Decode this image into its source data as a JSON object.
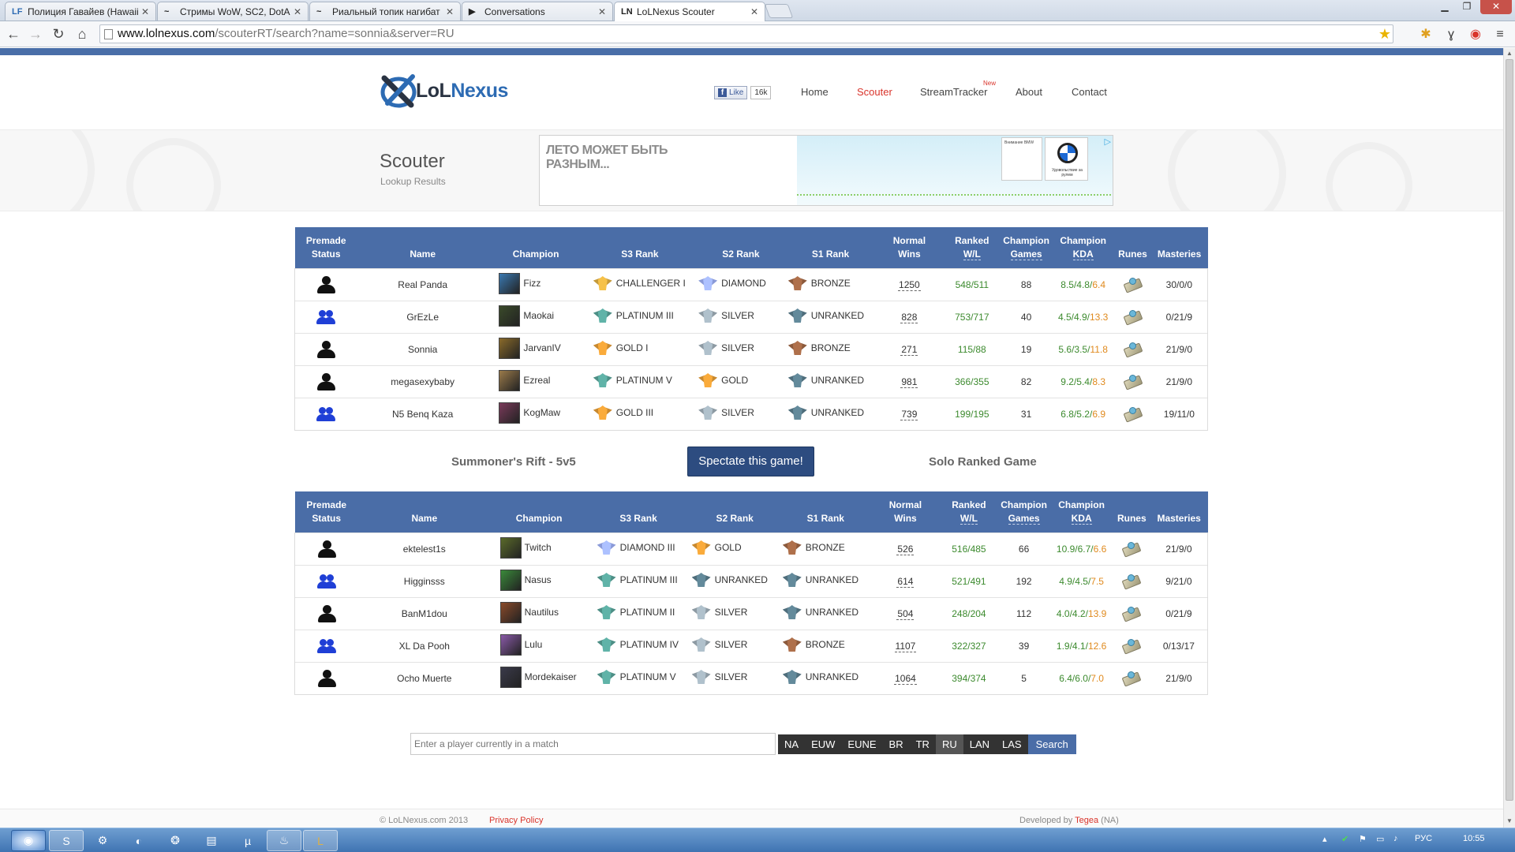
{
  "browser": {
    "tabs": [
      {
        "icon": "LF",
        "title": "Полиция Гавайев (Hawaii"
      },
      {
        "icon": "~",
        "title": "Стримы WoW, SC2, DotA"
      },
      {
        "icon": "~",
        "title": "Риальный топик нагибат"
      },
      {
        "icon": "▶",
        "title": "Conversations"
      },
      {
        "icon": "LN",
        "title": "LoLNexus Scouter"
      }
    ],
    "url_host": "www.lolnexus.com",
    "url_path": "/scouterRT/search?name=sonnia&server=RU"
  },
  "site": {
    "logo_lol": "LoL",
    "logo_nexus": "Nexus",
    "fb_like": "Like",
    "fb_count": "16k",
    "nav": [
      {
        "label": "Home",
        "active": false
      },
      {
        "label": "Scouter",
        "active": true
      },
      {
        "label": "StreamTracker",
        "active": false
      },
      {
        "label": "About",
        "active": false
      },
      {
        "label": "Contact",
        "active": false
      }
    ],
    "nav_new_badge": "New",
    "page_title": "Scouter",
    "page_subtitle": "Lookup Results",
    "ad_text": "ЛЕТО МОЖЕТ БЫТЬ РАЗНЫМ...",
    "ad_bmw_text": "Удовольствие за рулем",
    "ad_small_text": "Внимание BMW"
  },
  "table_headers": {
    "premade": [
      "Premade",
      "Status"
    ],
    "name": "Name",
    "champion": "Champion",
    "s3": "S3 Rank",
    "s2": "S2 Rank",
    "s1": "S1 Rank",
    "normal": [
      "Normal",
      "Wins"
    ],
    "ranked": [
      "Ranked",
      "W/L"
    ],
    "games": [
      "Champion",
      "Games"
    ],
    "kda": [
      "Champion",
      "KDA"
    ],
    "runes": "Runes",
    "masteries": "Masteries"
  },
  "team1": [
    {
      "premade": "solo",
      "name": "Real Panda",
      "champion": "Fizz",
      "champ_color": "#3a78b0",
      "s3": "CHALLENGER I",
      "s3_tier": "challenger",
      "s2": "DIAMOND",
      "s2_tier": "diamond",
      "s1": "BRONZE",
      "s1_tier": "bronze",
      "normal_wins": "1250",
      "ranked_wl": "548/511",
      "games": "88",
      "kda": "8.5/4.8/",
      "kda_ratio": "6.4",
      "masteries": "30/0/0"
    },
    {
      "premade": "group",
      "name": "GrEzLe",
      "champion": "Maokai",
      "champ_color": "#3a4a2a",
      "s3": "PLATINUM III",
      "s3_tier": "platinum",
      "s2": "SILVER",
      "s2_tier": "silver",
      "s1": "UNRANKED",
      "s1_tier": "unranked",
      "normal_wins": "828",
      "ranked_wl": "753/717",
      "games": "40",
      "kda": "4.5/4.9/",
      "kda_ratio": "13.3",
      "masteries": "0/21/9"
    },
    {
      "premade": "solo",
      "name": "Sonnia",
      "champion": "JarvanIV",
      "champ_color": "#8a6a2a",
      "s3": "GOLD I",
      "s3_tier": "gold",
      "s2": "SILVER",
      "s2_tier": "silver",
      "s1": "BRONZE",
      "s1_tier": "bronze",
      "normal_wins": "271",
      "ranked_wl": "115/88",
      "games": "19",
      "kda": "5.6/3.5/",
      "kda_ratio": "11.8",
      "masteries": "21/9/0"
    },
    {
      "premade": "solo",
      "name": "megasexybaby",
      "champion": "Ezreal",
      "champ_color": "#9a7a4a",
      "s3": "PLATINUM V",
      "s3_tier": "platinum",
      "s2": "GOLD",
      "s2_tier": "gold",
      "s1": "UNRANKED",
      "s1_tier": "unranked",
      "normal_wins": "981",
      "ranked_wl": "366/355",
      "games": "82",
      "kda": "9.2/5.4/",
      "kda_ratio": "8.3",
      "masteries": "21/9/0"
    },
    {
      "premade": "group",
      "name": "N5 Benq Kaza",
      "champion": "KogMaw",
      "champ_color": "#7a3a5a",
      "s3": "GOLD III",
      "s3_tier": "gold",
      "s2": "SILVER",
      "s2_tier": "silver",
      "s1": "UNRANKED",
      "s1_tier": "unranked",
      "normal_wins": "739",
      "ranked_wl": "199/195",
      "games": "31",
      "kda": "6.8/5.2/",
      "kda_ratio": "6.9",
      "masteries": "19/11/0"
    }
  ],
  "game": {
    "mode": "Summoner's Rift - 5v5",
    "spectate_label": "Spectate this game!",
    "queue": "Solo Ranked Game"
  },
  "team2": [
    {
      "premade": "solo",
      "name": "ektelest1s",
      "champion": "Twitch",
      "champ_color": "#5a6a2a",
      "s3": "DIAMOND III",
      "s3_tier": "diamond",
      "s2": "GOLD",
      "s2_tier": "gold",
      "s1": "BRONZE",
      "s1_tier": "bronze",
      "normal_wins": "526",
      "ranked_wl": "516/485",
      "games": "66",
      "kda": "10.9/6.7/",
      "kda_ratio": "6.6",
      "masteries": "21/9/0"
    },
    {
      "premade": "group",
      "name": "Higginsss",
      "champion": "Nasus",
      "champ_color": "#3a8a3a",
      "s3": "PLATINUM III",
      "s3_tier": "platinum",
      "s2": "UNRANKED",
      "s2_tier": "unranked",
      "s1": "UNRANKED",
      "s1_tier": "unranked",
      "normal_wins": "614",
      "ranked_wl": "521/491",
      "games": "192",
      "kda": "4.9/4.5/",
      "kda_ratio": "7.5",
      "masteries": "9/21/0"
    },
    {
      "premade": "solo",
      "name": "BanM1dou",
      "champion": "Nautilus",
      "champ_color": "#8a4a2a",
      "s3": "PLATINUM II",
      "s3_tier": "platinum",
      "s2": "SILVER",
      "s2_tier": "silver",
      "s1": "UNRANKED",
      "s1_tier": "unranked",
      "normal_wins": "504",
      "ranked_wl": "248/204",
      "games": "112",
      "kda": "4.0/4.2/",
      "kda_ratio": "13.9",
      "masteries": "0/21/9"
    },
    {
      "premade": "group",
      "name": "XL Da Pooh",
      "champion": "Lulu",
      "champ_color": "#8a5aa8",
      "s3": "PLATINUM IV",
      "s3_tier": "platinum",
      "s2": "SILVER",
      "s2_tier": "silver",
      "s1": "BRONZE",
      "s1_tier": "bronze",
      "normal_wins": "1107",
      "ranked_wl": "322/327",
      "games": "39",
      "kda": "1.9/4.1/",
      "kda_ratio": "12.6",
      "masteries": "0/13/17"
    },
    {
      "premade": "solo",
      "name": "Ocho Muerte",
      "champion": "Mordekaiser",
      "champ_color": "#3a3a4a",
      "s3": "PLATINUM V",
      "s3_tier": "platinum",
      "s2": "SILVER",
      "s2_tier": "silver",
      "s1": "UNRANKED",
      "s1_tier": "unranked",
      "normal_wins": "1064",
      "ranked_wl": "394/374",
      "games": "5",
      "kda": "6.4/6.0/",
      "kda_ratio": "7.0",
      "masteries": "21/9/0"
    }
  ],
  "search": {
    "placeholder": "Enter a player currently in a match",
    "servers": [
      "NA",
      "EUW",
      "EUNE",
      "BR",
      "TR",
      "RU",
      "LAN",
      "LAS"
    ],
    "active_server": "RU",
    "button": "Search"
  },
  "footer": {
    "copyright": "© LoLNexus.com 2013",
    "privacy": "Privacy Policy",
    "developed_by": "Developed by ",
    "developer": "Tegea",
    "developer_region": " (NA)"
  },
  "taskbar": {
    "lang": "РУС",
    "time": "10:55"
  },
  "colors": {
    "header_blue": "#4a6da7",
    "accent_red": "#d9342b",
    "win_green": "#3c8a2e",
    "kda_orange": "#e08a1e",
    "premade_blue": "#1f3fd6",
    "tier_challenger": "#c59a3a",
    "tier_diamond": "#8a9ad8",
    "tier_platinum": "#4d8f86",
    "tier_gold": "#c8892f",
    "tier_silver": "#8d9aa3",
    "tier_bronze": "#8c5a3c",
    "tier_unranked": "#4f6e7c"
  }
}
